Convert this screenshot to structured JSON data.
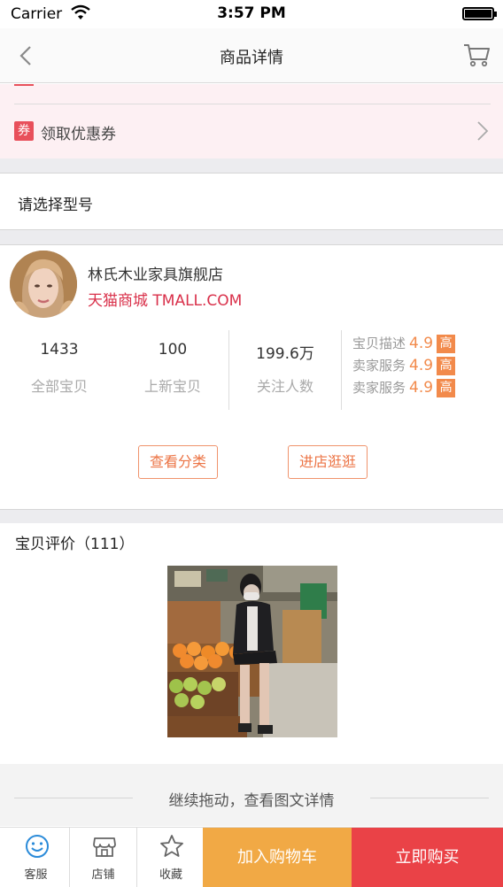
{
  "status_bar": {
    "carrier": "Carrier",
    "time": "3:57 PM"
  },
  "nav": {
    "title": "商品详情",
    "back_icon": "chevron-left-icon",
    "cart_icon": "cart-icon"
  },
  "coupon": {
    "tag": "券",
    "label": "领取优惠券"
  },
  "model": {
    "label": "请选择型号"
  },
  "shop": {
    "name": "林氏木业家具旗舰店",
    "mall": "天猫商城 TMALL.COM",
    "stats": [
      {
        "num": "1433",
        "label": "全部宝贝"
      },
      {
        "num": "100",
        "label": "上新宝贝"
      },
      {
        "num": "199.6万",
        "label": "关注人数"
      }
    ],
    "ratings": [
      {
        "label": "宝贝描述",
        "score": "4.9",
        "level": "高"
      },
      {
        "label": "卖家服务",
        "score": "4.9",
        "level": "高"
      },
      {
        "label": "卖家服务",
        "score": "4.9",
        "level": "高"
      }
    ],
    "view_category": "查看分类",
    "visit_store": "进店逛逛"
  },
  "reviews": {
    "title": "宝贝评价（111）"
  },
  "more": {
    "text": "继续拖动，查看图文详情"
  },
  "tabbar": {
    "service": "客服",
    "store": "店铺",
    "favorite": "收藏",
    "add_cart": "加入购物车",
    "buy_now": "立即购买"
  },
  "colors": {
    "accent_red": "#ea4247",
    "accent_orange": "#f1a945",
    "rating_orange": "#f28a4b",
    "mall_red": "#d9304a"
  }
}
